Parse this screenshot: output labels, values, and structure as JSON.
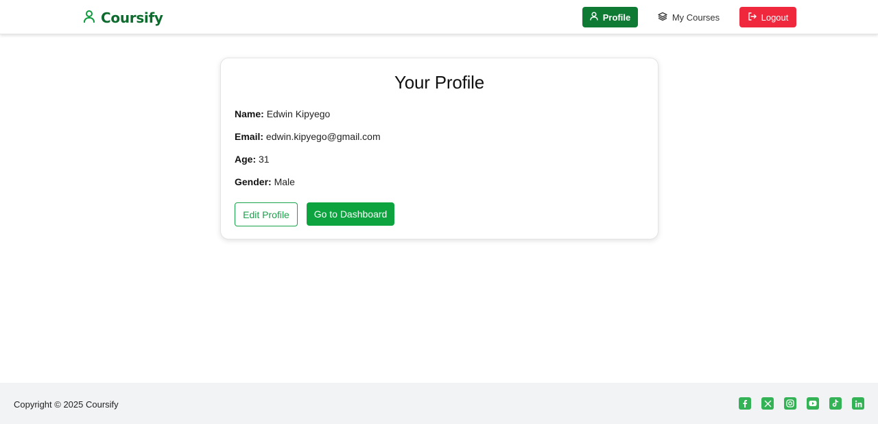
{
  "header": {
    "brand": "Coursify",
    "nav": {
      "profile_label": "Profile",
      "courses_label": "My Courses",
      "logout_label": "Logout"
    }
  },
  "profile": {
    "title": "Your Profile",
    "fields": [
      {
        "label": "Name:",
        "value": "Edwin Kipyego"
      },
      {
        "label": "Email:",
        "value": "edwin.kipyego@gmail.com"
      },
      {
        "label": "Age:",
        "value": "31"
      },
      {
        "label": "Gender:",
        "value": "Male"
      }
    ],
    "edit_button": "Edit Profile",
    "dashboard_button": "Go to Dashboard"
  },
  "footer": {
    "copyright": "Copyright © 2025 Coursify",
    "social_icons": [
      "facebook-icon",
      "x-icon",
      "instagram-icon",
      "youtube-icon",
      "tiktok-icon",
      "linkedin-icon"
    ]
  },
  "colors": {
    "brand_green": "#0d6b2e",
    "primary_green": "#0da33f",
    "logout_red": "#f0283e",
    "footer_bg": "#f2f3f5"
  }
}
